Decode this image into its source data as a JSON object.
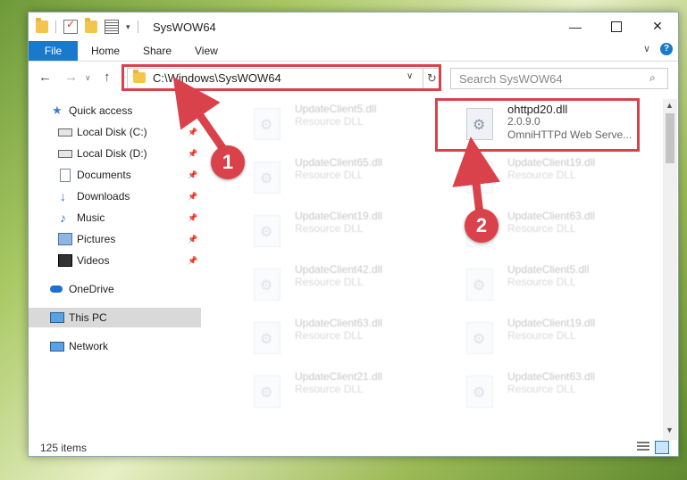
{
  "window": {
    "title": "SysWOW64",
    "minimize": "—",
    "close": "✕"
  },
  "ribbon": {
    "file": "File",
    "home": "Home",
    "share": "Share",
    "view": "View",
    "expand": "∨",
    "help": "?"
  },
  "nav": {
    "back": "←",
    "forward": "→",
    "history": "∨",
    "up": "↑"
  },
  "address": {
    "path": "C:\\Windows\\SysWOW64",
    "dropdown": "∨",
    "refresh": "↻"
  },
  "search": {
    "placeholder": "Search SysWOW64",
    "icon": "⌕"
  },
  "sidebar": {
    "items": [
      {
        "label": "Quick access",
        "icon": "star-icon",
        "pinned": false
      },
      {
        "label": "Local Disk (C:)",
        "icon": "drive-icon",
        "pinned": true
      },
      {
        "label": "Local Disk (D:)",
        "icon": "drive-icon",
        "pinned": true
      },
      {
        "label": "Documents",
        "icon": "documents-icon",
        "pinned": true
      },
      {
        "label": "Downloads",
        "icon": "downloads-icon",
        "pinned": true
      },
      {
        "label": "Music",
        "icon": "music-icon",
        "pinned": true
      },
      {
        "label": "Pictures",
        "icon": "pictures-icon",
        "pinned": true
      },
      {
        "label": "Videos",
        "icon": "videos-icon",
        "pinned": true
      },
      {
        "label": "OneDrive",
        "icon": "onedrive-icon",
        "pinned": false
      },
      {
        "label": "This PC",
        "icon": "this-pc-icon",
        "pinned": false,
        "selected": true
      },
      {
        "label": "Network",
        "icon": "network-icon",
        "pinned": false
      }
    ],
    "pin_glyph": "📌"
  },
  "files": [
    {
      "name": "UpdateClient5.dll",
      "desc": "Resource DLL"
    },
    {
      "name": "ohttpd20.dll",
      "version": "2.0.9.0",
      "desc": "OmniHTTPd Web Serve...",
      "highlighted": true
    },
    {
      "name": "UpdateClient65.dll",
      "desc": "Resource DLL"
    },
    {
      "name": "UpdateClient19.dll",
      "desc": "Resource DLL"
    },
    {
      "name": "UpdateClient19.dll",
      "desc": "Resource DLL"
    },
    {
      "name": "UpdateClient63.dll",
      "desc": "Resource DLL"
    },
    {
      "name": "UpdateClient42.dll",
      "desc": "Resource DLL"
    },
    {
      "name": "UpdateClient5.dll",
      "desc": "Resource DLL"
    },
    {
      "name": "UpdateClient63.dll",
      "desc": "Resource DLL"
    },
    {
      "name": "UpdateClient19.dll",
      "desc": "Resource DLL"
    },
    {
      "name": "UpdateClient21.dll",
      "desc": "Resource DLL"
    },
    {
      "name": "UpdateClient63.dll",
      "desc": "Resource DLL"
    }
  ],
  "status": {
    "count": "125 items"
  },
  "scrollbar": {
    "up": "▲",
    "down": "▼"
  },
  "annotations": {
    "step1": "1",
    "step2": "2",
    "color": "#d9424a"
  }
}
